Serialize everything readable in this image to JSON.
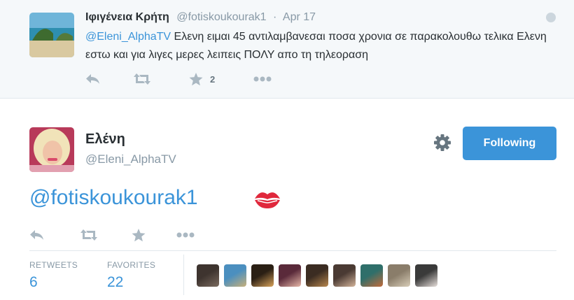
{
  "parent_tweet": {
    "display_name": "Ιφιγένεια Κρήτη",
    "handle": "@fotiskoukourak1",
    "separator": "·",
    "timestamp": "Apr 17",
    "mention": "@Eleni_AlphaTV",
    "text": " Ελενη ειμαι 45 αντιλαμβανεσαι ποσα χρονια σε παρακολουθω τελικα Ελενη εστω και για λιγες μερες λειπεις ΠΟΛΥ απο τη τηλεοραση",
    "favorites_count": "2"
  },
  "main_tweet": {
    "display_name": "Ελένη",
    "handle": "@Eleni_AlphaTV",
    "follow_label": "Following",
    "text": "@fotiskoukourak1",
    "emoji": "kiss-mark-icon"
  },
  "stats": {
    "retweets_label": "RETWEETS",
    "retweets_value": "6",
    "favorites_label": "FAVORITES",
    "favorites_value": "22"
  },
  "colors": {
    "accent": "#3b94d9",
    "muted": "#8899a6",
    "action_icon": "#aab8c2",
    "kiss_red": "#e0283c"
  },
  "favoriter_avatars": [
    {
      "name": "favoriter-avatar",
      "color_a": "#3e342f",
      "color_b": "#7a6a5e"
    },
    {
      "name": "favoriter-avatar",
      "color_a": "#4b8fbf",
      "color_b": "#c8b07a"
    },
    {
      "name": "favoriter-avatar",
      "color_a": "#2a1f14",
      "color_b": "#d9a35a"
    },
    {
      "name": "favoriter-avatar",
      "color_a": "#5a2a3a",
      "color_b": "#e7b7a8"
    },
    {
      "name": "favoriter-avatar",
      "color_a": "#3b2c22",
      "color_b": "#b8874e"
    },
    {
      "name": "favoriter-avatar",
      "color_a": "#4a3a33",
      "color_b": "#d4b49a"
    },
    {
      "name": "favoriter-avatar",
      "color_a": "#2f6f6a",
      "color_b": "#c26a3a"
    },
    {
      "name": "favoriter-avatar",
      "color_a": "#8a7d6a",
      "color_b": "#d8cdb8"
    },
    {
      "name": "favoriter-avatar",
      "color_a": "#3a3a3a",
      "color_b": "#e8e0dc"
    }
  ]
}
